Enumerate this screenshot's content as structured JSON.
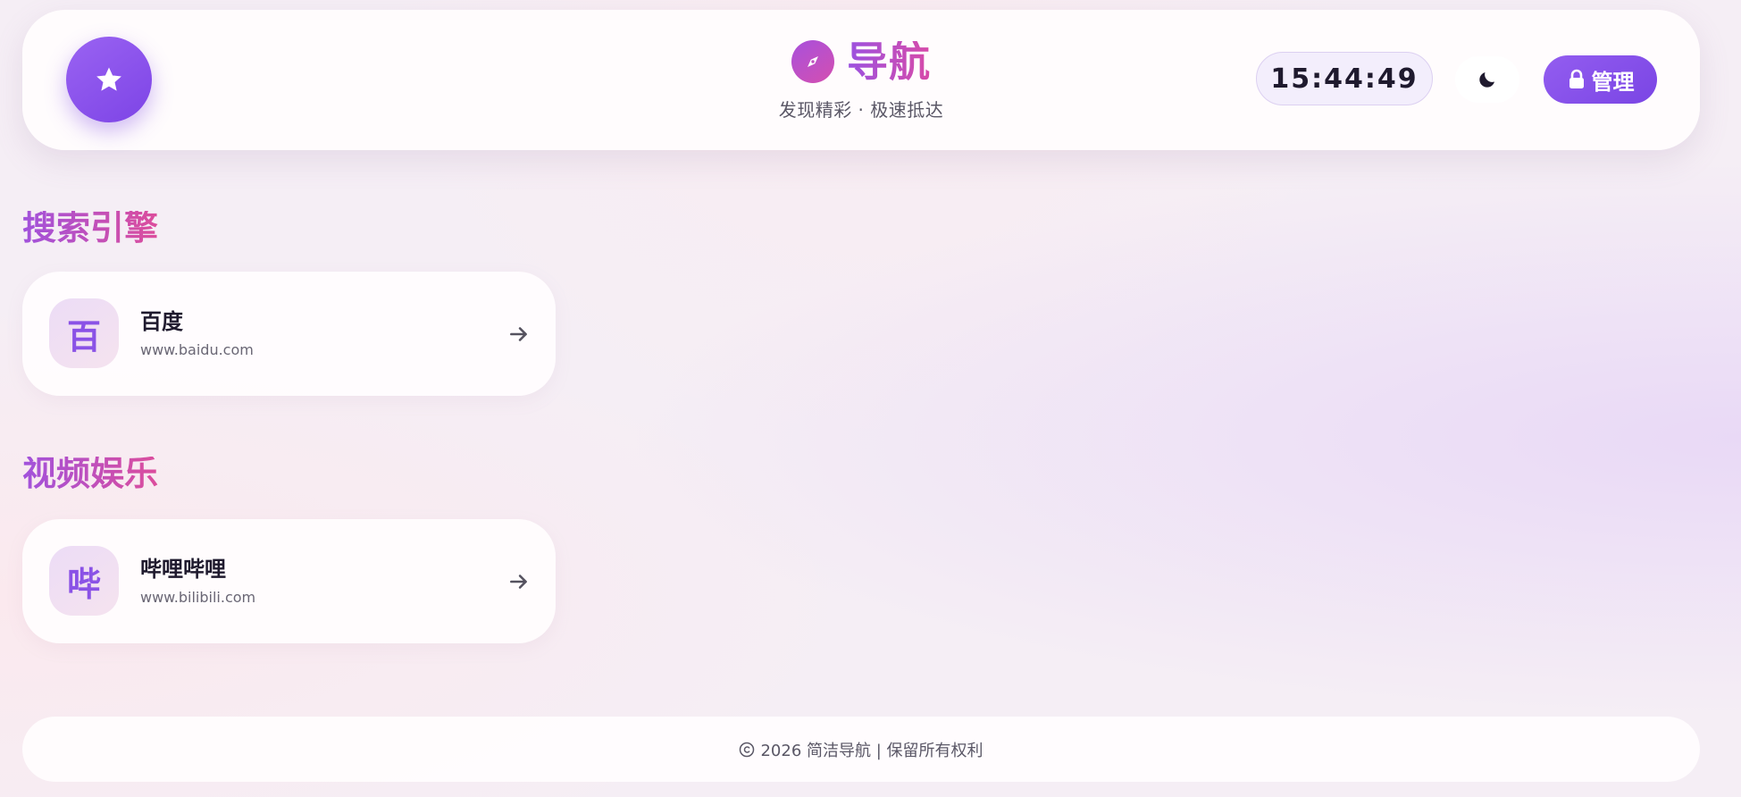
{
  "header": {
    "star_icon": "star-icon",
    "brand_icon": "compass-icon",
    "title": "导航",
    "subtitle": "发现精彩 · 极速抵达",
    "clock": "15:44:49",
    "theme_icon": "moon-icon",
    "admin_label": "管理",
    "admin_icon": "lock-icon"
  },
  "sections": [
    {
      "title": "搜索引擎",
      "links": [
        {
          "icon_char": "百",
          "name": "百度",
          "url": "www.baidu.com"
        }
      ]
    },
    {
      "title": "视频娱乐",
      "links": [
        {
          "icon_char": "哔",
          "name": "哔哩哔哩",
          "url": "www.bilibili.com"
        }
      ]
    }
  ],
  "footer": {
    "copyright_icon": "copyright-icon",
    "text": "2026 简洁导航 | 保留所有权利"
  },
  "colors": {
    "accent_purple": "#8a52e6",
    "accent_pink": "#d84aa8",
    "text_dark": "#1f1a2e",
    "text_muted": "#5a5766"
  }
}
